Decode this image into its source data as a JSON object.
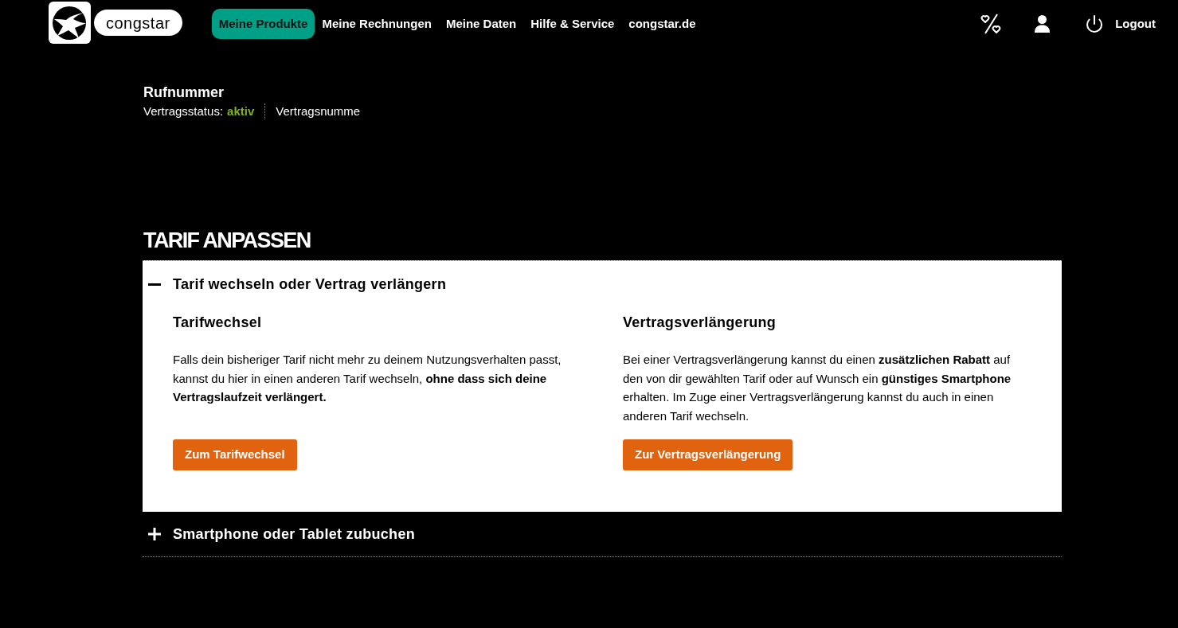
{
  "header": {
    "brand": "congstar",
    "nav": [
      {
        "label": "Meine Produkte",
        "selected": true
      },
      {
        "label": "Meine Rechnungen",
        "selected": false
      },
      {
        "label": "Meine Daten",
        "selected": false
      },
      {
        "label": "Hilfe & Service",
        "selected": false
      },
      {
        "label": "congstar.de",
        "selected": false
      }
    ],
    "logout": "Logout"
  },
  "contract": {
    "title": "Rufnummer",
    "status_label": "Vertragsstatus:",
    "status_value": "aktiv",
    "number_label": "Vertragsnumme"
  },
  "section": {
    "title": "TARIF ANPASSEN",
    "accordion": [
      {
        "title": "Tarif wechseln oder Vertrag verlängern",
        "expanded": true,
        "columns": [
          {
            "heading": "Tarifwechsel",
            "text": "Falls dein bisheriger Tarif nicht mehr zu deinem Nutzungsverhalten passt, kannst du hier in einen anderen Tarif wechseln, **ohne dass sich deine Vertragslaufzeit verlängert.**",
            "button": "Zum Tarifwechsel"
          },
          {
            "heading": "Vertragsverlängerung",
            "text": "Bei einer Vertragsverlängerung kannst du einen **zusätzlichen Rabatt** auf den von dir gewählten Tarif oder auf Wunsch ein **günstiges Smartphone** erhalten. Im Zuge einer Vertragsverlängerung kannst du auch in einen anderen Tarif wechseln.",
            "button": "Zur Vertragsverlängerung"
          }
        ]
      },
      {
        "title": "Smartphone oder Tablet zubuchen",
        "expanded": false
      }
    ]
  }
}
